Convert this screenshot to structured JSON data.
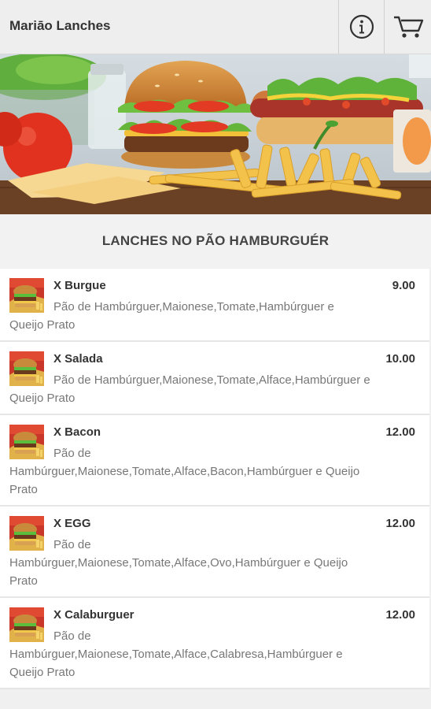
{
  "header": {
    "title": "Mariāo Lanches",
    "info_icon": "info-icon",
    "cart_icon": "cart-icon"
  },
  "hero": {
    "image": "burger-hotdog-fries-banner"
  },
  "section": {
    "title": "LANCHES NO PÃO HAMBURGUÉR"
  },
  "items": [
    {
      "name": "X Burgue",
      "price": "9.00",
      "description": "Pão de Hambúrguer,Maionese,Tomate,Hambúrguer e Queijo Prato",
      "thumb_icon": "burger-thumbnail"
    },
    {
      "name": "X Salada",
      "price": "10.00",
      "description": "Pão de Hambúrguer,Maionese,Tomate,Alface,Hambúrguer e Queijo Prato",
      "thumb_icon": "burger-thumbnail"
    },
    {
      "name": "X Bacon",
      "price": "12.00",
      "description": "Pão de Hambúrguer,Maionese,Tomate,Alface,Bacon,Hambúrguer e Queijo Prato",
      "thumb_icon": "burger-thumbnail"
    },
    {
      "name": "X EGG",
      "price": "12.00",
      "description": "Pão de Hambúrguer,Maionese,Tomate,Alface,Ovo,Hambúrguer e Queijo Prato",
      "thumb_icon": "burger-thumbnail"
    },
    {
      "name": "X Calaburguer",
      "price": "12.00",
      "description": "Pão de Hambúrguer,Maionese,Tomate,Alface,Calabresa,Hambúrguer e Queijo Prato",
      "thumb_icon": "burger-thumbnail"
    }
  ]
}
